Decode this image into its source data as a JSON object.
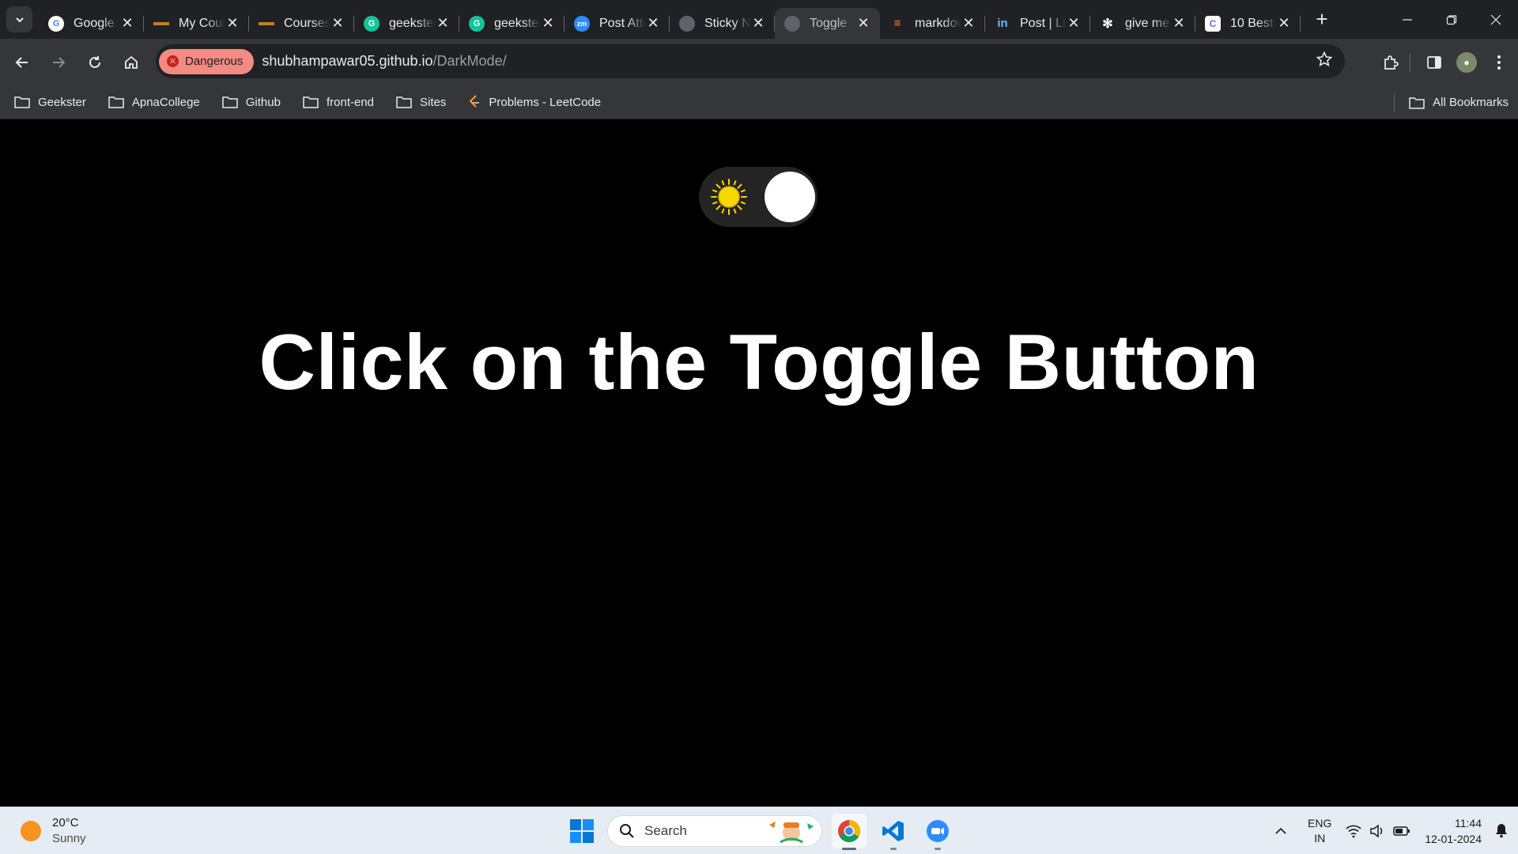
{
  "browser": {
    "tabs": [
      {
        "title": "Google",
        "favicon": "google-icon",
        "active": false
      },
      {
        "title": "My Courses",
        "favicon": "geekster-icon",
        "active": false
      },
      {
        "title": "Courses",
        "favicon": "geekster-icon",
        "active": false
      },
      {
        "title": "geekster",
        "favicon": "grammarly-icon",
        "active": false
      },
      {
        "title": "geekster",
        "favicon": "grammarly-icon",
        "active": false
      },
      {
        "title": "Post Attendee",
        "favicon": "zoom-icon",
        "active": false
      },
      {
        "title": "Sticky Notes",
        "favicon": "globe-icon",
        "active": false
      },
      {
        "title": "Toggle",
        "favicon": "globe-icon",
        "active": true
      },
      {
        "title": "markdown",
        "favicon": "stackoverflow-icon",
        "active": false
      },
      {
        "title": "Post | LinkedIn",
        "favicon": "linkedin-icon",
        "active": false
      },
      {
        "title": "give me",
        "favicon": "openai-icon",
        "active": false
      },
      {
        "title": "10 Best",
        "favicon": "clickup-icon",
        "active": false
      }
    ],
    "address": {
      "security_label": "Dangerous",
      "domain": "shubhampawar05.github.io",
      "path": "/DarkMode/"
    },
    "bookmarks": [
      {
        "label": "Geekster",
        "icon": "folder-icon"
      },
      {
        "label": "ApnaCollege",
        "icon": "folder-icon"
      },
      {
        "label": "Github",
        "icon": "folder-icon"
      },
      {
        "label": "front-end",
        "icon": "folder-icon"
      },
      {
        "label": "Sites",
        "icon": "folder-icon"
      },
      {
        "label": "Problems - LeetCode",
        "icon": "leetcode-icon"
      }
    ],
    "all_bookmarks_label": "All Bookmarks"
  },
  "page": {
    "toggle_state": "light",
    "headline": "Click on the Toggle Button"
  },
  "taskbar": {
    "weather": {
      "temp": "20°C",
      "condition": "Sunny"
    },
    "search_placeholder": "Search",
    "apps": [
      "chrome-icon",
      "vscode-icon",
      "zoom-icon"
    ],
    "lang_line1": "ENG",
    "lang_line2": "IN",
    "time": "11:44",
    "date": "12-01-2024"
  },
  "colors": {
    "danger_chip": "#f28b82",
    "page_bg": "#000000",
    "headline": "#ffffff",
    "sun": "#f5d800"
  }
}
